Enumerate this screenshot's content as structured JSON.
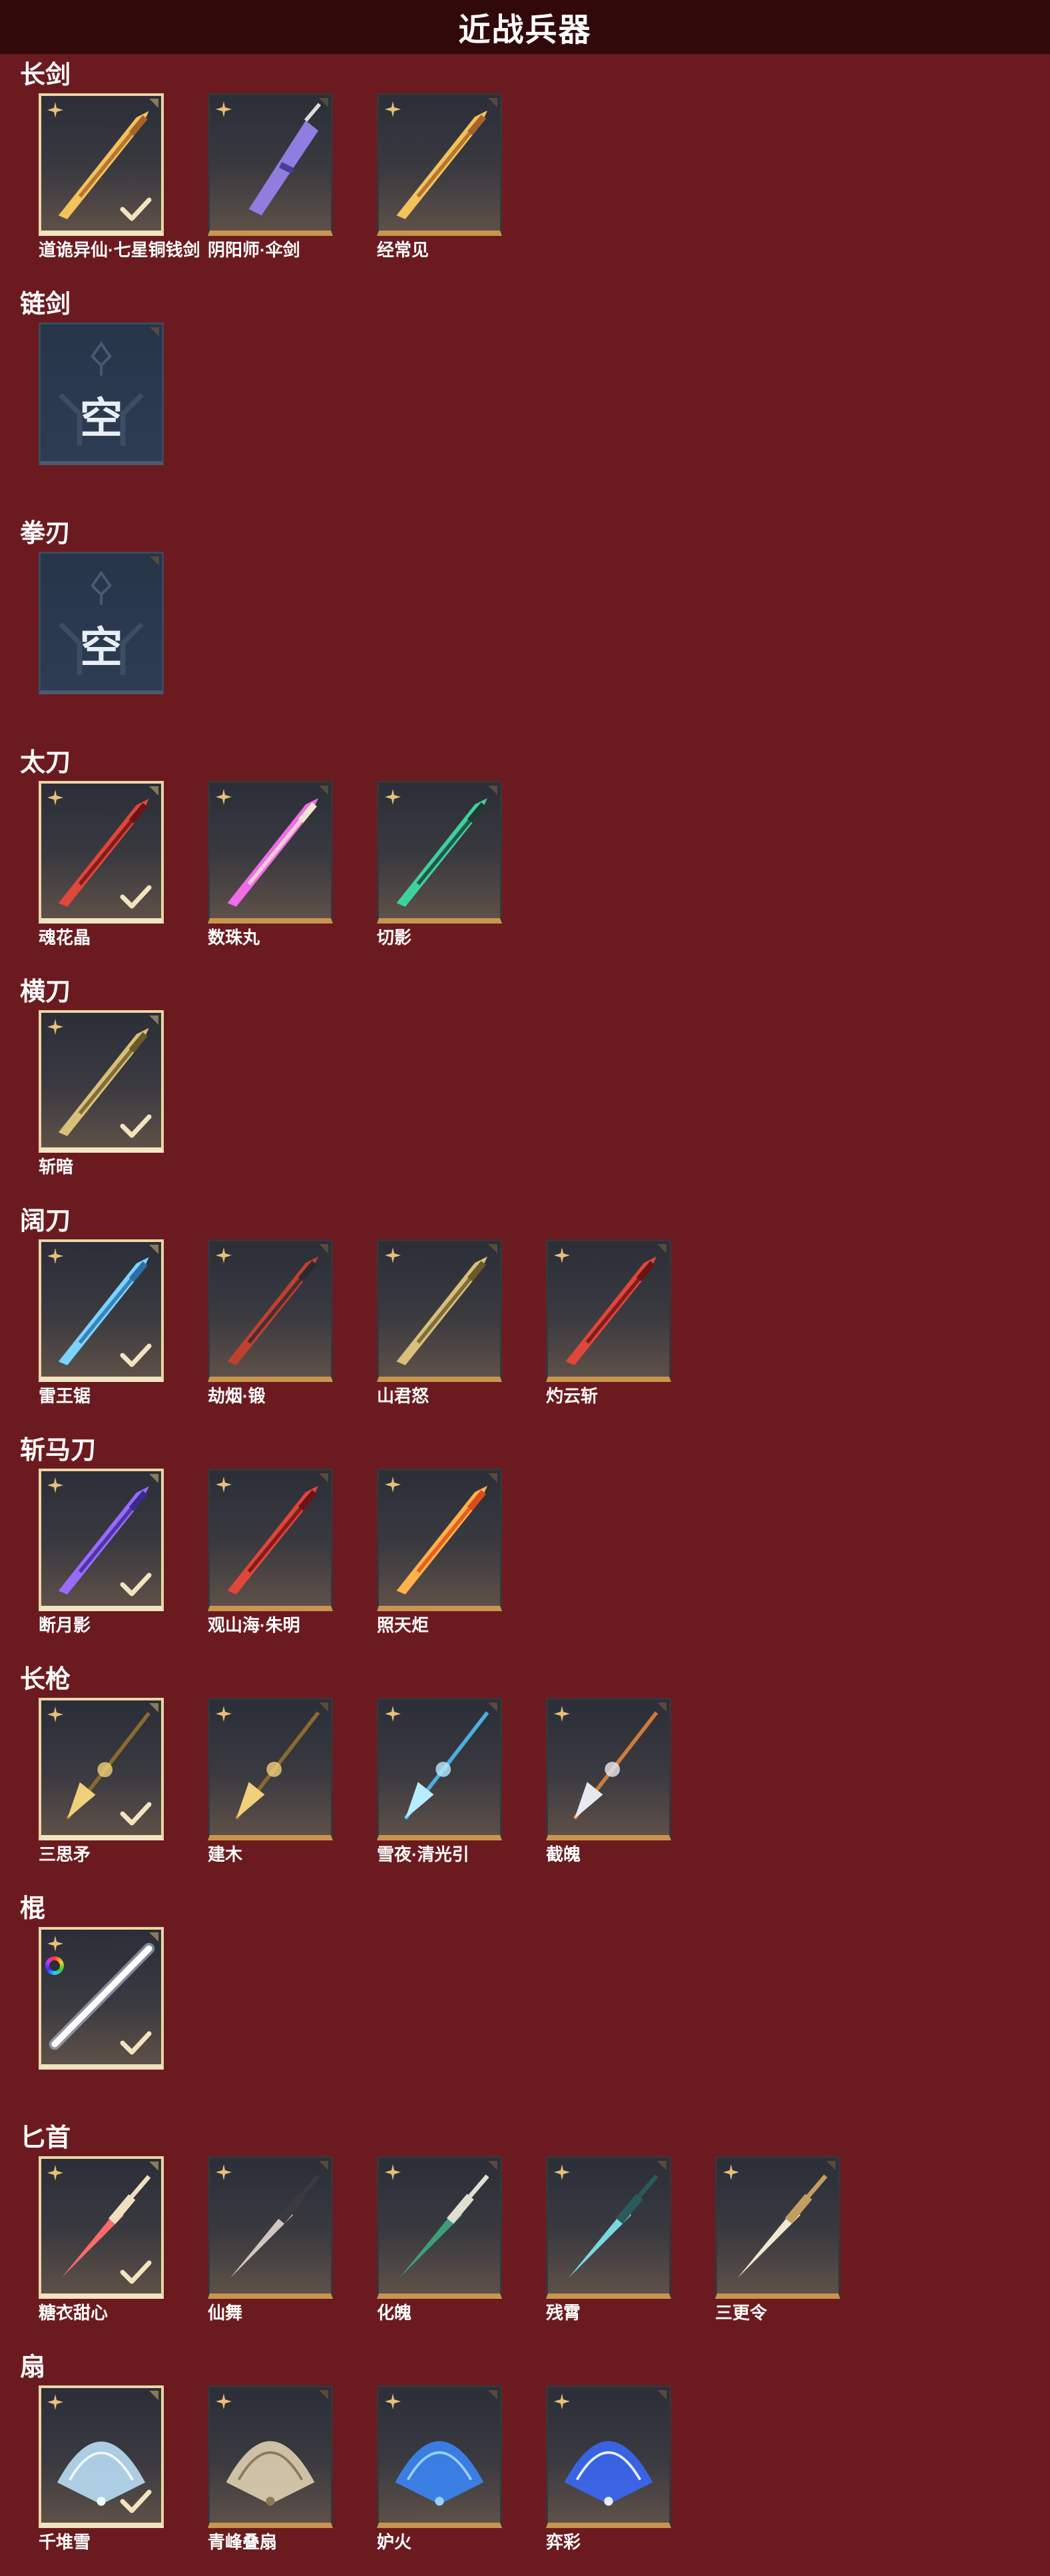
{
  "header": {
    "title": "近战兵器"
  },
  "sections": [
    {
      "title": "长剑",
      "items": [
        {
          "name": "道诡异仙·七星铜钱剑",
          "owned": true,
          "art": "sword-gold"
        },
        {
          "name": "阴阳师·伞剑",
          "owned": false,
          "art": "umbrella-purple"
        },
        {
          "name": "经常见",
          "owned": false,
          "art": "sword-gold"
        }
      ]
    },
    {
      "title": "链剑",
      "items": [
        {
          "name": "",
          "empty": true,
          "empty_label": "空"
        }
      ]
    },
    {
      "title": "拳刃",
      "items": [
        {
          "name": "",
          "empty": true,
          "empty_label": "空"
        }
      ]
    },
    {
      "title": "太刀",
      "items": [
        {
          "name": "魂花晶",
          "owned": true,
          "art": "blade-red"
        },
        {
          "name": "数珠丸",
          "owned": false,
          "art": "blade-pink"
        },
        {
          "name": "切影",
          "owned": false,
          "art": "blade-green"
        }
      ]
    },
    {
      "title": "横刀",
      "items": [
        {
          "name": "斩暗",
          "owned": true,
          "art": "blade-gold"
        }
      ]
    },
    {
      "title": "阔刀",
      "items": [
        {
          "name": "雷王锯",
          "owned": true,
          "art": "blade-blue"
        },
        {
          "name": "劫烟·锻",
          "owned": false,
          "art": "blade-dark"
        },
        {
          "name": "山君怒",
          "owned": false,
          "art": "blade-gold"
        },
        {
          "name": "灼云斩",
          "owned": false,
          "art": "blade-red"
        }
      ]
    },
    {
      "title": "斩马刀",
      "items": [
        {
          "name": "断月影",
          "owned": true,
          "art": "blade-purple"
        },
        {
          "name": "观山海·朱明",
          "owned": false,
          "art": "blade-red"
        },
        {
          "name": "照天炬",
          "owned": false,
          "art": "blade-orange"
        }
      ]
    },
    {
      "title": "长枪",
      "items": [
        {
          "name": "三思矛",
          "owned": true,
          "art": "spear-gold"
        },
        {
          "name": "建木",
          "owned": false,
          "art": "spear-gold"
        },
        {
          "name": "雪夜·清光引",
          "owned": false,
          "art": "spear-blue"
        },
        {
          "name": "截魄",
          "owned": false,
          "art": "spear-silver"
        }
      ]
    },
    {
      "title": "棍",
      "items": [
        {
          "name": "",
          "owned": true,
          "art": "staff-white",
          "rainbow": true
        }
      ]
    },
    {
      "title": "匕首",
      "items": [
        {
          "name": "糖衣甜心",
          "owned": true,
          "art": "dagger-candy"
        },
        {
          "name": "仙舞",
          "owned": false,
          "art": "dagger-dark"
        },
        {
          "name": "化魄",
          "owned": false,
          "art": "dagger-green"
        },
        {
          "name": "残霄",
          "owned": false,
          "art": "dagger-teal"
        },
        {
          "name": "三更令",
          "owned": false,
          "art": "dagger-gold"
        }
      ]
    },
    {
      "title": "扇",
      "items": [
        {
          "name": "千堆雪",
          "owned": true,
          "art": "fan-ice"
        },
        {
          "name": "青峰叠扇",
          "owned": false,
          "art": "fan-beige"
        },
        {
          "name": "妒火",
          "owned": false,
          "art": "fan-blue"
        },
        {
          "name": "弈彩",
          "owned": false,
          "art": "fan-navy"
        }
      ]
    }
  ],
  "art_colors": {
    "sword-gold": [
      "#f3c25a",
      "#a8632a"
    ],
    "umbrella-purple": [
      "#8f7ee0",
      "#4a3c9a"
    ],
    "blade-red": [
      "#e0463a",
      "#6a1418"
    ],
    "blade-pink": [
      "#f06ce8",
      "#f0e6d0"
    ],
    "blade-green": [
      "#3fd0a0",
      "#1f3a30"
    ],
    "blade-gold": [
      "#d8c07a",
      "#6a5a2a"
    ],
    "blade-blue": [
      "#7ad4ff",
      "#2a6ea8"
    ],
    "blade-dark": [
      "#c04030",
      "#2a2a30"
    ],
    "blade-purple": [
      "#9a6aff",
      "#3a2a8a"
    ],
    "blade-orange": [
      "#ffb24a",
      "#e04a1a"
    ],
    "spear-gold": [
      "#f0d07a",
      "#8a6a30"
    ],
    "spear-blue": [
      "#b8ecff",
      "#4ab0e0"
    ],
    "spear-silver": [
      "#e8e8f0",
      "#d07a3a"
    ],
    "staff-white": [
      "#ffffff",
      "#cfd8ff"
    ],
    "dagger-candy": [
      "#ff6a6a",
      "#f0e0c0"
    ],
    "dagger-dark": [
      "#d0c8c0",
      "#3a3a40"
    ],
    "dagger-green": [
      "#3aa07a",
      "#e0e0d0"
    ],
    "dagger-teal": [
      "#7ad8e0",
      "#2a5a5a"
    ],
    "dagger-gold": [
      "#f0e8d0",
      "#c0a060"
    ],
    "fan-ice": [
      "#bfe6ff",
      "#f0f8ff"
    ],
    "fan-beige": [
      "#e8d8b8",
      "#8a7a5a"
    ],
    "fan-blue": [
      "#3a8aff",
      "#9ad0ff"
    ],
    "fan-navy": [
      "#3a6aff",
      "#e8eeff"
    ]
  }
}
